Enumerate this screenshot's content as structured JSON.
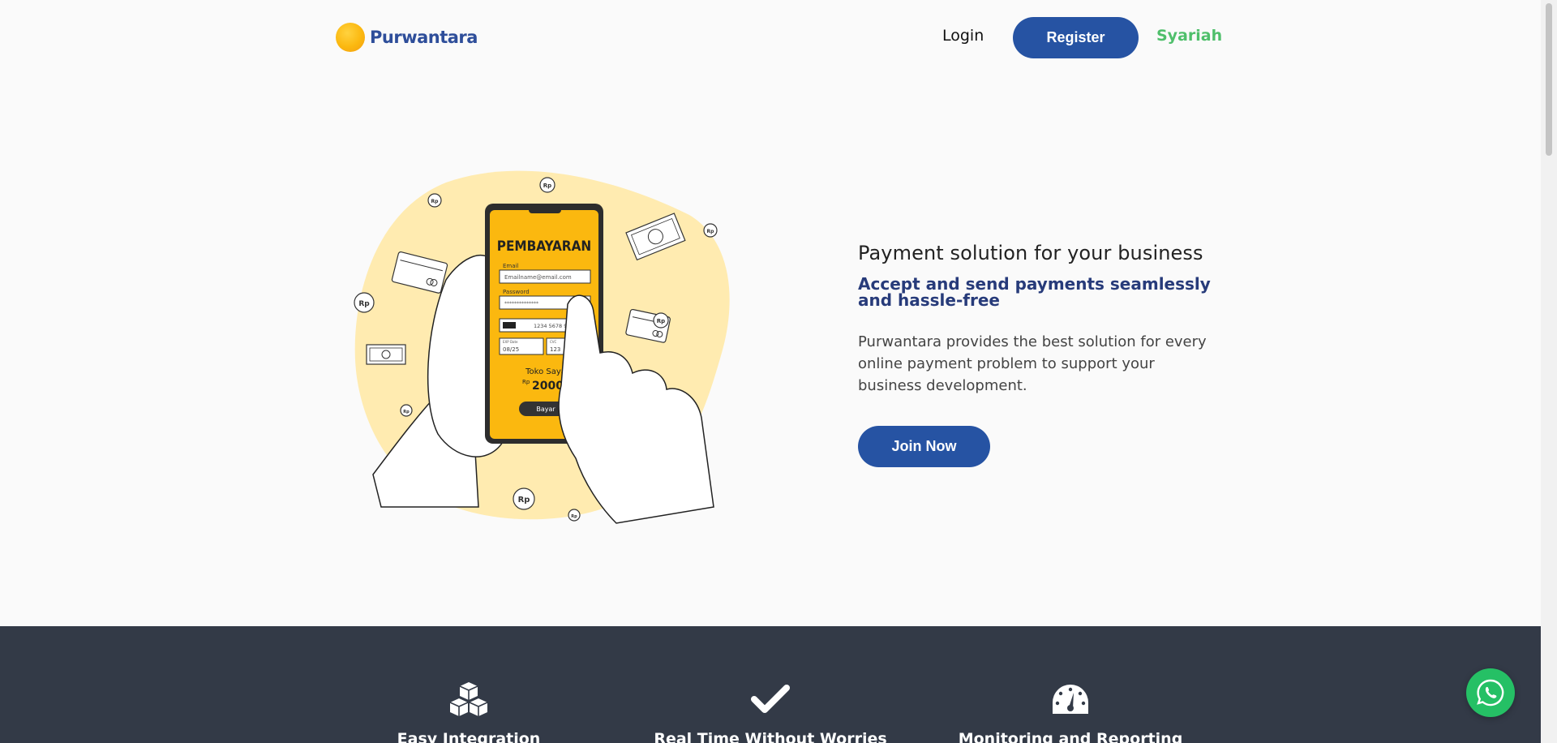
{
  "brand": {
    "name": "Purwantara"
  },
  "nav": {
    "login_label": "Login",
    "register_label": "Register",
    "syariah_label": "Syariah"
  },
  "hero": {
    "tagline": "Payment solution for your business",
    "headline": "Accept and send payments seamlessly and hassle-free",
    "description": "Purwantara provides the best solution for every online payment problem to support your business development.",
    "cta_label": "Join Now",
    "illustration": {
      "phone_title": "PEMBAYARAN",
      "email_label": "Email",
      "email_placeholder": "Emailname@email.com",
      "password_label": "Password",
      "password_mask": "**************",
      "card_number": "1234 5678 9101",
      "exp_label": "EXP Date",
      "exp_value": "08/25",
      "cvc_label": "CVC",
      "cvc_value": "123",
      "store_name": "Toko Saya",
      "currency": "Rp",
      "amount": "2000",
      "pay_label": "Bayar",
      "coin_label": "Rp"
    }
  },
  "features": [
    {
      "icon": "cubes-icon",
      "label": "Easy Integration"
    },
    {
      "icon": "check-icon",
      "label": "Real Time Without Worries"
    },
    {
      "icon": "gauge-icon",
      "label": "Monitoring and Reporting"
    }
  ],
  "colors": {
    "primary": "#2653a3",
    "headline": "#273b7a",
    "syariah": "#4fbf6b",
    "band": "#333a47",
    "yellow": "#fbb80f",
    "whatsapp": "#25c065"
  }
}
